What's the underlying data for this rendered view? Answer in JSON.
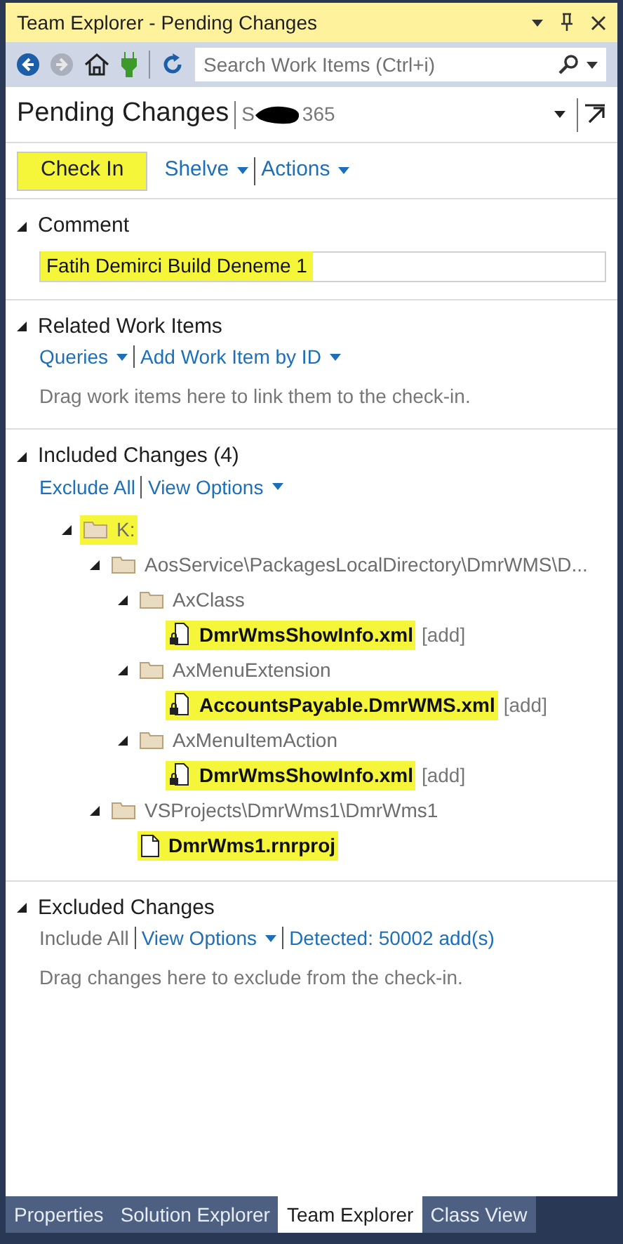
{
  "window": {
    "title": "Team Explorer - Pending Changes",
    "highlighted": true
  },
  "toolbar": {
    "search": {
      "placeholder": "Search Work Items (Ctrl+i)"
    }
  },
  "header": {
    "title": "Pending Changes",
    "subtitle_start": "S",
    "subtitle_end": "365"
  },
  "actions": [
    {
      "label": "Check In",
      "kind": "button",
      "highlighted": true
    },
    {
      "label": "Shelve",
      "kind": "dropdown",
      "highlighted": false
    },
    {
      "label": "Actions",
      "kind": "dropdown",
      "highlighted": false
    }
  ],
  "comment": {
    "title": "Comment",
    "expanded": true,
    "value": "Fatih Demirci Build Deneme 1",
    "highlighted": true
  },
  "related": {
    "title": "Related Work Items",
    "expanded": true,
    "links": [
      {
        "label": "Queries",
        "dropdown": true,
        "muted": false
      },
      {
        "label": "Add Work Item by ID",
        "dropdown": true,
        "muted": false
      }
    ],
    "hint": "Drag work items here to link them to the check-in."
  },
  "included": {
    "title": "Included Changes (4)",
    "expanded": true,
    "links": [
      {
        "label": "Exclude All",
        "dropdown": false,
        "muted": false
      },
      {
        "label": "View Options",
        "dropdown": true,
        "muted": false
      }
    ],
    "tree": [
      {
        "kind": "folder",
        "label": "K:",
        "highlighted": true,
        "expanded": true,
        "children": [
          {
            "kind": "folder",
            "label": "AosService\\PackagesLocalDirectory\\DmrWMS\\D...",
            "highlighted": false,
            "expanded": true,
            "children": [
              {
                "kind": "folder",
                "label": "AxClass",
                "highlighted": false,
                "expanded": true,
                "children": [
                  {
                    "kind": "file",
                    "label": "DmrWmsShowInfo.xml",
                    "tag": "[add]",
                    "highlighted": true
                  }
                ]
              },
              {
                "kind": "folder",
                "label": "AxMenuExtension",
                "highlighted": false,
                "expanded": true,
                "children": [
                  {
                    "kind": "file",
                    "label": "AccountsPayable.DmrWMS.xml",
                    "tag": "[add]",
                    "highlighted": true
                  }
                ]
              },
              {
                "kind": "folder",
                "label": "AxMenuItemAction",
                "highlighted": false,
                "expanded": true,
                "children": [
                  {
                    "kind": "file",
                    "label": "DmrWmsShowInfo.xml",
                    "tag": "[add]",
                    "highlighted": true
                  }
                ]
              }
            ]
          },
          {
            "kind": "folder",
            "label": "VSProjects\\DmrWms1\\DmrWms1",
            "highlighted": false,
            "expanded": true,
            "children": [
              {
                "kind": "project",
                "label": "DmrWms1.rnrproj",
                "highlighted": true
              }
            ]
          }
        ]
      }
    ]
  },
  "excluded": {
    "title": "Excluded Changes",
    "expanded": true,
    "links": [
      {
        "label": "Include All",
        "dropdown": false,
        "muted": true
      },
      {
        "label": "View Options",
        "dropdown": true,
        "muted": false
      },
      {
        "label": "Detected: 50002 add(s)",
        "dropdown": false,
        "muted": false
      }
    ],
    "hint": "Drag changes here to exclude from the check-in."
  },
  "bottom_tabs": [
    {
      "label": "Properties",
      "selected": false
    },
    {
      "label": "Solution Explorer",
      "selected": false
    },
    {
      "label": "Team Explorer",
      "selected": true
    },
    {
      "label": "Class View",
      "selected": false
    }
  ]
}
